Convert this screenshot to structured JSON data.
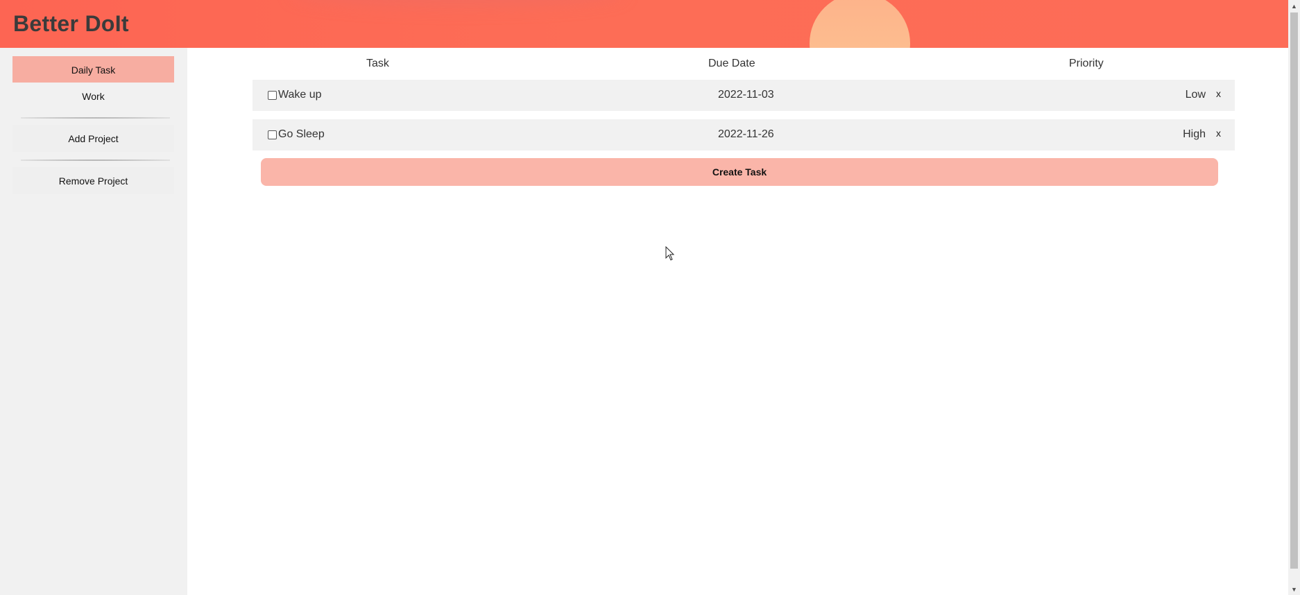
{
  "app": {
    "title": "Better DoIt"
  },
  "colors": {
    "header": "#fd6553",
    "sun": "#fdb28a",
    "active_project": "#f7ada1",
    "create_button": "#fab5a9"
  },
  "sidebar": {
    "projects": [
      {
        "label": "Daily Task",
        "active": true
      },
      {
        "label": "Work",
        "active": false
      }
    ],
    "add_project_label": "Add Project",
    "remove_project_label": "Remove Project"
  },
  "main": {
    "columns": {
      "task": "Task",
      "due_date": "Due Date",
      "priority": "Priority"
    },
    "tasks": [
      {
        "name": "Wake up",
        "due": "2022-11-03",
        "priority": "Low",
        "delete": "x",
        "checked": false
      },
      {
        "name": "Go Sleep",
        "due": "2022-11-26",
        "priority": "High",
        "delete": "x",
        "checked": false
      }
    ],
    "create_task_label": "Create Task"
  },
  "scrollbar": {
    "up_icon": "▲",
    "down_icon": "▼"
  }
}
